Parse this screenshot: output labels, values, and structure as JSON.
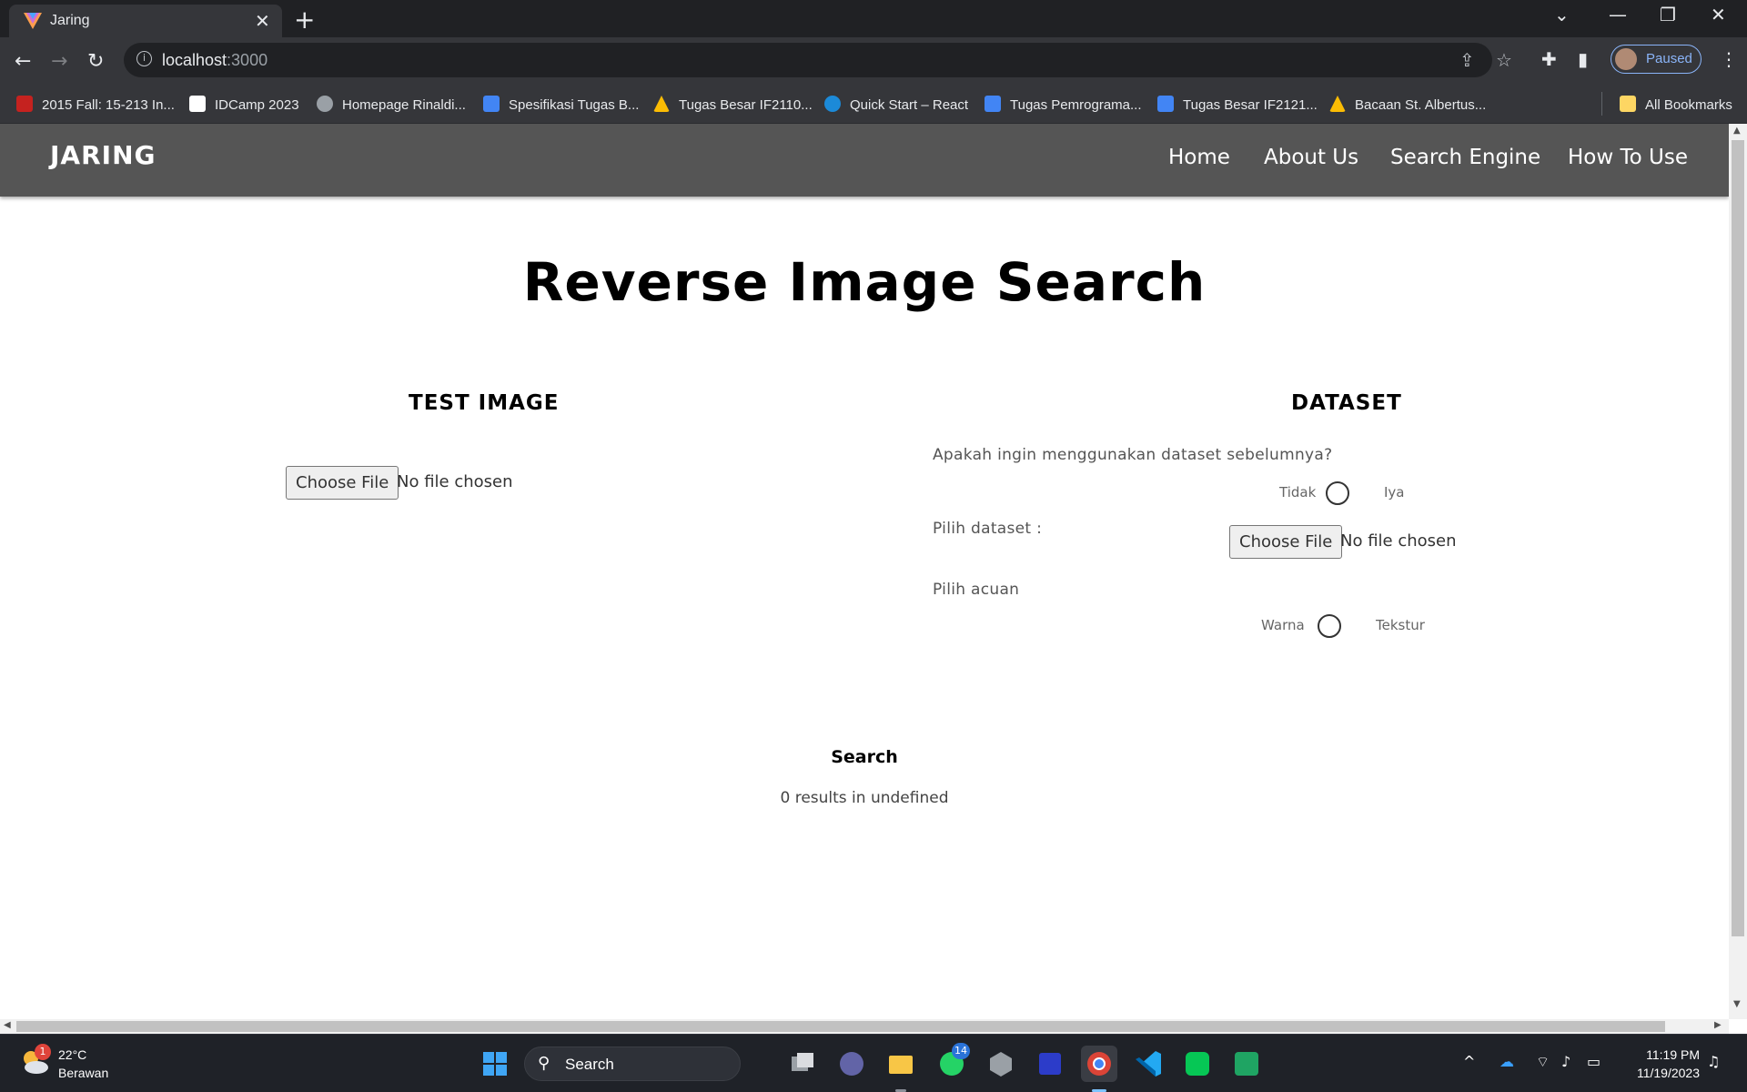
{
  "browser": {
    "tab_title": "Jaring",
    "url_host": "localhost",
    "url_port": ":3000",
    "profile_label": "Paused",
    "bookmarks": [
      {
        "label": "2015 Fall: 15-213 In...",
        "color": "#c5221f"
      },
      {
        "label": "IDCamp 2023",
        "color": "#ffffff"
      },
      {
        "label": "Homepage Rinaldi...",
        "color": "#9aa0a6"
      },
      {
        "label": "Spesifikasi Tugas B...",
        "color": "#4285f4"
      },
      {
        "label": "Tugas Besar IF2110...",
        "color": "#fbbc04"
      },
      {
        "label": "Quick Start – React",
        "color": "#1c8ad8"
      },
      {
        "label": "Tugas Pemrograma...",
        "color": "#4285f4"
      },
      {
        "label": "Tugas Besar IF2121...",
        "color": "#4285f4"
      },
      {
        "label": "Bacaan St. Albertus...",
        "color": "#fbbc04"
      }
    ],
    "all_bookmarks_label": "All Bookmarks"
  },
  "site": {
    "brand": "JARING",
    "nav": [
      "Home",
      "About Us",
      "Search Engine",
      "How To Use"
    ]
  },
  "main": {
    "title": "Reverse Image Search",
    "test_image": {
      "heading": "TEST IMAGE",
      "file_button": "Choose File",
      "file_status": "No file chosen"
    },
    "dataset": {
      "heading": "DATASET",
      "question": "Apakah ingin menggunakan dataset sebelumnya?",
      "toggle_left": "Tidak",
      "toggle_right": "Iya",
      "pick_label": "Pilih dataset :",
      "file_button": "Choose File",
      "file_status": "No file chosen",
      "acuan_label": "Pilih acuan",
      "acuan_left": "Warna",
      "acuan_right": "Tekstur"
    },
    "search_label": "Search",
    "results_text": "0 results in undefined"
  },
  "taskbar": {
    "temperature": "22°C",
    "weather": "Berawan",
    "weather_badge": "1",
    "search_label": "Search",
    "whatsapp_badge": "14",
    "time": "11:19 PM",
    "date": "11/19/2023"
  }
}
